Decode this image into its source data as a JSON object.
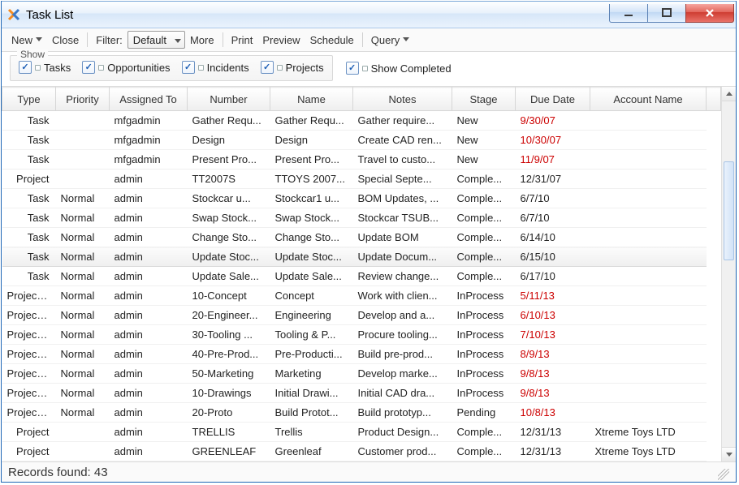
{
  "window": {
    "title": "Task List"
  },
  "toolbar": {
    "new": "New",
    "close": "Close",
    "filter_label": "Filter:",
    "filter_value": "Default",
    "more": "More",
    "print": "Print",
    "preview": "Preview",
    "schedule": "Schedule",
    "query": "Query"
  },
  "show_group": {
    "legend": "Show",
    "tasks": "Tasks",
    "opportunities": "Opportunities",
    "incidents": "Incidents",
    "projects": "Projects"
  },
  "show_completed": "Show Completed",
  "columns": {
    "type": "Type",
    "priority": "Priority",
    "assigned": "Assigned To",
    "number": "Number",
    "name": "Name",
    "notes": "Notes",
    "stage": "Stage",
    "due": "Due Date",
    "account": "Account Name"
  },
  "rows": [
    {
      "type": "Task",
      "priority": "",
      "assigned": "mfgadmin",
      "number": "Gather Requ...",
      "name": "Gather Requ...",
      "notes": "Gather require...",
      "stage": "New",
      "due": "9/30/07",
      "due_red": true,
      "account": ""
    },
    {
      "type": "Task",
      "priority": "",
      "assigned": "mfgadmin",
      "number": "Design",
      "name": "Design",
      "notes": "Create CAD ren...",
      "stage": "New",
      "due": "10/30/07",
      "due_red": true,
      "account": ""
    },
    {
      "type": "Task",
      "priority": "",
      "assigned": "mfgadmin",
      "number": "Present Pro...",
      "name": "Present Pro...",
      "notes": "Travel to custo...",
      "stage": "New",
      "due": "11/9/07",
      "due_red": true,
      "account": ""
    },
    {
      "type": "Project",
      "priority": "",
      "assigned": "admin",
      "number": "TT2007S",
      "name": "TTOYS 2007...",
      "notes": "Special Septe...",
      "stage": "Comple...",
      "due": "12/31/07",
      "due_red": false,
      "account": ""
    },
    {
      "type": "Task",
      "priority": "Normal",
      "assigned": "admin",
      "number": "Stockcar u...",
      "name": "Stockcar1 u...",
      "notes": "BOM Updates, ...",
      "stage": "Comple...",
      "due": "6/7/10",
      "due_red": false,
      "account": ""
    },
    {
      "type": "Task",
      "priority": "Normal",
      "assigned": "admin",
      "number": "Swap Stock...",
      "name": "Swap Stock...",
      "notes": "Stockcar TSUB...",
      "stage": "Comple...",
      "due": "6/7/10",
      "due_red": false,
      "account": ""
    },
    {
      "type": "Task",
      "priority": "Normal",
      "assigned": "admin",
      "number": "Change Sto...",
      "name": "Change Sto...",
      "notes": "Update BOM",
      "stage": "Comple...",
      "due": "6/14/10",
      "due_red": false,
      "account": ""
    },
    {
      "type": "Task",
      "priority": "Normal",
      "assigned": "admin",
      "number": "Update Stoc...",
      "name": "Update Stoc...",
      "notes": "Update Docum...",
      "stage": "Comple...",
      "due": "6/15/10",
      "due_red": false,
      "account": "",
      "sel": true
    },
    {
      "type": "Task",
      "priority": "Normal",
      "assigned": "admin",
      "number": "Update Sale...",
      "name": "Update Sale...",
      "notes": "Review change...",
      "stage": "Comple...",
      "due": "6/17/10",
      "due_red": false,
      "account": ""
    },
    {
      "type": "Project ...",
      "priority": "Normal",
      "assigned": "admin",
      "number": "10-Concept",
      "name": "Concept",
      "notes": "Work with clien...",
      "stage": "InProcess",
      "due": "5/11/13",
      "due_red": true,
      "account": ""
    },
    {
      "type": "Project ...",
      "priority": "Normal",
      "assigned": "admin",
      "number": "20-Engineer...",
      "name": "Engineering",
      "notes": "Develop and a...",
      "stage": "InProcess",
      "due": "6/10/13",
      "due_red": true,
      "account": ""
    },
    {
      "type": "Project ...",
      "priority": "Normal",
      "assigned": "admin",
      "number": "30-Tooling ...",
      "name": "Tooling & P...",
      "notes": "Procure tooling...",
      "stage": "InProcess",
      "due": "7/10/13",
      "due_red": true,
      "account": ""
    },
    {
      "type": "Project ...",
      "priority": "Normal",
      "assigned": "admin",
      "number": "40-Pre-Prod...",
      "name": "Pre-Producti...",
      "notes": "Build pre-prod...",
      "stage": "InProcess",
      "due": "8/9/13",
      "due_red": true,
      "account": ""
    },
    {
      "type": "Project ...",
      "priority": "Normal",
      "assigned": "admin",
      "number": "50-Marketing",
      "name": "Marketing",
      "notes": "Develop marke...",
      "stage": "InProcess",
      "due": "9/8/13",
      "due_red": true,
      "account": ""
    },
    {
      "type": "Project ...",
      "priority": "Normal",
      "assigned": "admin",
      "number": "10-Drawings",
      "name": "Initial Drawi...",
      "notes": "Initial CAD dra...",
      "stage": "InProcess",
      "due": "9/8/13",
      "due_red": true,
      "account": ""
    },
    {
      "type": "Project ...",
      "priority": "Normal",
      "assigned": "admin",
      "number": "20-Proto",
      "name": "Build Protot...",
      "notes": "Build prototyp...",
      "stage": "Pending",
      "due": "10/8/13",
      "due_red": true,
      "account": ""
    },
    {
      "type": "Project",
      "priority": "",
      "assigned": "admin",
      "number": "TRELLIS",
      "name": "Trellis",
      "notes": "Product Design...",
      "stage": "Comple...",
      "due": "12/31/13",
      "due_red": false,
      "account": "Xtreme Toys LTD"
    },
    {
      "type": "Project",
      "priority": "",
      "assigned": "admin",
      "number": "GREENLEAF",
      "name": "Greenleaf",
      "notes": "Customer prod...",
      "stage": "Comple...",
      "due": "12/31/13",
      "due_red": false,
      "account": "Xtreme Toys LTD"
    }
  ],
  "status": {
    "records": "Records found: 43"
  }
}
